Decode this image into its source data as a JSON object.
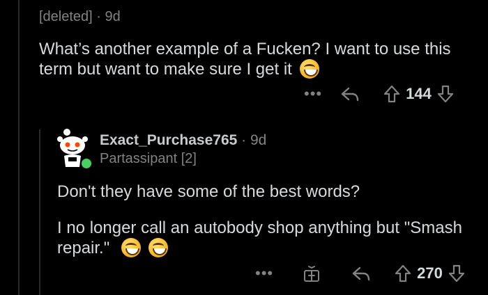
{
  "parent_comment": {
    "author": "[deleted]",
    "separator": "·",
    "age": "9d",
    "body": "What’s another example of a Fucken? I want to use this term but want to make sure I get it",
    "emoji": "grinning-face-emoji",
    "more_label": "•••",
    "score": "144"
  },
  "reply_comment": {
    "author": "Exact_Purchase765",
    "separator": "·",
    "age": "9d",
    "flair": "Partassipant [2]",
    "body_line1": "Don't they have some of the best words?",
    "body_line2": "I no longer call an autobody shop anything but \"Smash repair.\"",
    "emojis": [
      "laughing-emoji",
      "laughing-emoji"
    ],
    "more_label": "•••",
    "score": "270",
    "online_status_color": "#46d160"
  },
  "colors": {
    "background": "#000000",
    "text_primary": "#d7dadc",
    "text_secondary": "#818384",
    "online": "#46d160"
  }
}
